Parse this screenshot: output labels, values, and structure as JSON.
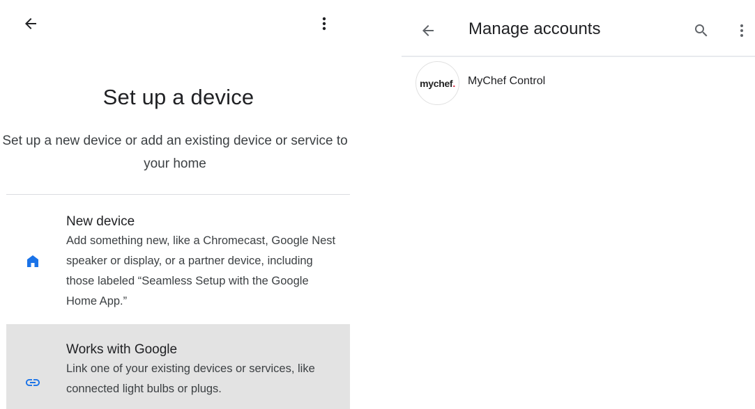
{
  "left": {
    "title": "Set up a device",
    "subtitle": "Set up a new device or add an existing device or service to your home",
    "options": [
      {
        "title": "New device",
        "description": "Add something new, like a Chromecast, Google Nest speaker or display, or a partner device, including those labeled “Seamless Setup with the Google Home App.”",
        "icon": "home-icon"
      },
      {
        "title": "Works with Google",
        "description": "Link one of your existing devices or services, like connected light bulbs or plugs.",
        "icon": "link-icon"
      }
    ]
  },
  "right": {
    "title": "Manage accounts",
    "accounts": [
      {
        "name": "MyChef Control",
        "logo_text": "mychef",
        "logo_dot": "."
      }
    ]
  },
  "colors": {
    "accent_blue": "#1a73e8",
    "selected_bg": "#e3e3e3",
    "logo_red": "#d6203a"
  }
}
